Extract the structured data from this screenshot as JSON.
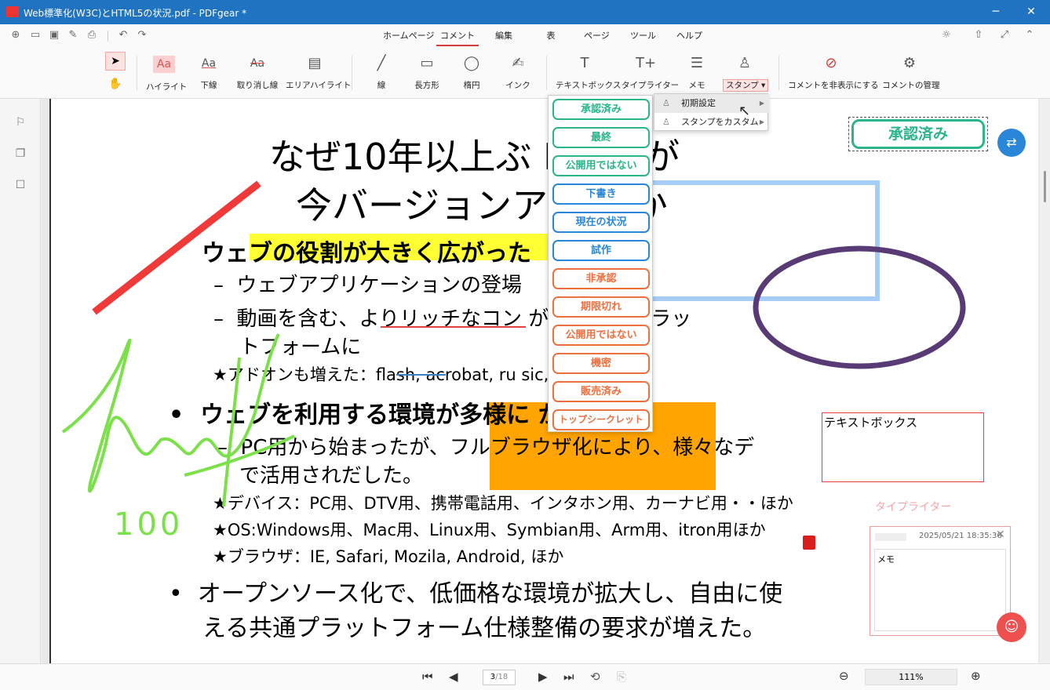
{
  "window": {
    "title": "Web標準化(W3C)とHTML5の状況.pdf - PDFgear *",
    "minimize": "─",
    "maximize": "☐",
    "close": "✕"
  },
  "quickbar": {
    "icons": [
      "new-file-icon",
      "open-folder-icon",
      "save-icon",
      "save-as-icon",
      "print-icon",
      "undo-icon",
      "redo-icon"
    ],
    "tabs": [
      "ホームページ",
      "コメント",
      "編集",
      "表",
      "ページ",
      "ツール",
      "ヘルプ"
    ],
    "right_icons": [
      "settings-icon",
      "share-icon",
      "fullscreen-icon",
      "collapse-icon"
    ]
  },
  "toolbar": {
    "tools": [
      "ハイライト",
      "下線",
      "取り消し線",
      "エリアハイライト",
      "線",
      "長方形",
      "楕円",
      "インク",
      "テキストボックス",
      "タイプライター",
      "メモ",
      "スタンプ",
      "コメントを非表示にする",
      "コメントの管理"
    ],
    "icon_glyphs": {
      "highlight": "Aa",
      "underline": "Aa",
      "strike": "Aa"
    }
  },
  "stamp_menu": {
    "stamps": [
      {
        "label": "承認済み",
        "color": "#2bb58a"
      },
      {
        "label": "最終",
        "color": "#2bb58a"
      },
      {
        "label": "公開用ではない",
        "color": "#2bb58a"
      },
      {
        "label": "下書き",
        "color": "#2a86d8"
      },
      {
        "label": "現在の状況",
        "color": "#2a86d8"
      },
      {
        "label": "試作",
        "color": "#2a86d8"
      },
      {
        "label": "非承認",
        "color": "#ee7040"
      },
      {
        "label": "期限切れ",
        "color": "#ee7040"
      },
      {
        "label": "公開用ではない",
        "color": "#ee7040"
      },
      {
        "label": "機密",
        "color": "#ee7040"
      },
      {
        "label": "販売済み",
        "color": "#ee7040"
      },
      {
        "label": "トップシークレット",
        "color": "#ee7040"
      }
    ],
    "submenu": [
      "初期設定",
      "スタンプをカスタム"
    ]
  },
  "document": {
    "title_line1": "なぜ10年以上ぶ HTMLが",
    "title_line2": "今バージョンア  るのか",
    "bullet1": "ウェブの役割が大きく広がった",
    "sub1": "ウェブアプリケーションの登場",
    "sub2a": "動画を含む、よりリッチなコン  が流通するプラッ",
    "sub2b": "トフォームに",
    "star1": "★アドオンも増えた：flash, acrobat, ru       sic, ほか",
    "bullet2": "ウェブを利用する環境が多様に    から",
    "sub3a": "PC用から始まったが、フルブラウザ化により、様々なデ",
    "sub3b": "で活用されだした。",
    "star2": "★デバイス：PC用、DTV用、携帯電話用、インタホン用、カーナビ用・・ほか",
    "star3": "★OS:Windows用、Mac用、Linux用、Symbian用、Arm用、itron用ほか",
    "star4": "★ブラウザ：IE, Safari, Mozila, Android, ほか",
    "bullet3a": "オープンソース化で、低価格な環境が拡大し、自由に使",
    "bullet3b": "える共通プラットフォーム仕様整備の要求が増えた。",
    "ink_text": "100",
    "stamp_placed": "承認済み",
    "textbox": "テキストボックス",
    "typewriter": "タイプライター"
  },
  "memo": {
    "date": "2025/05/21 18:35:36",
    "body": "メモ"
  },
  "status": {
    "page": "3",
    "total": "/18",
    "zoom": "111%"
  }
}
